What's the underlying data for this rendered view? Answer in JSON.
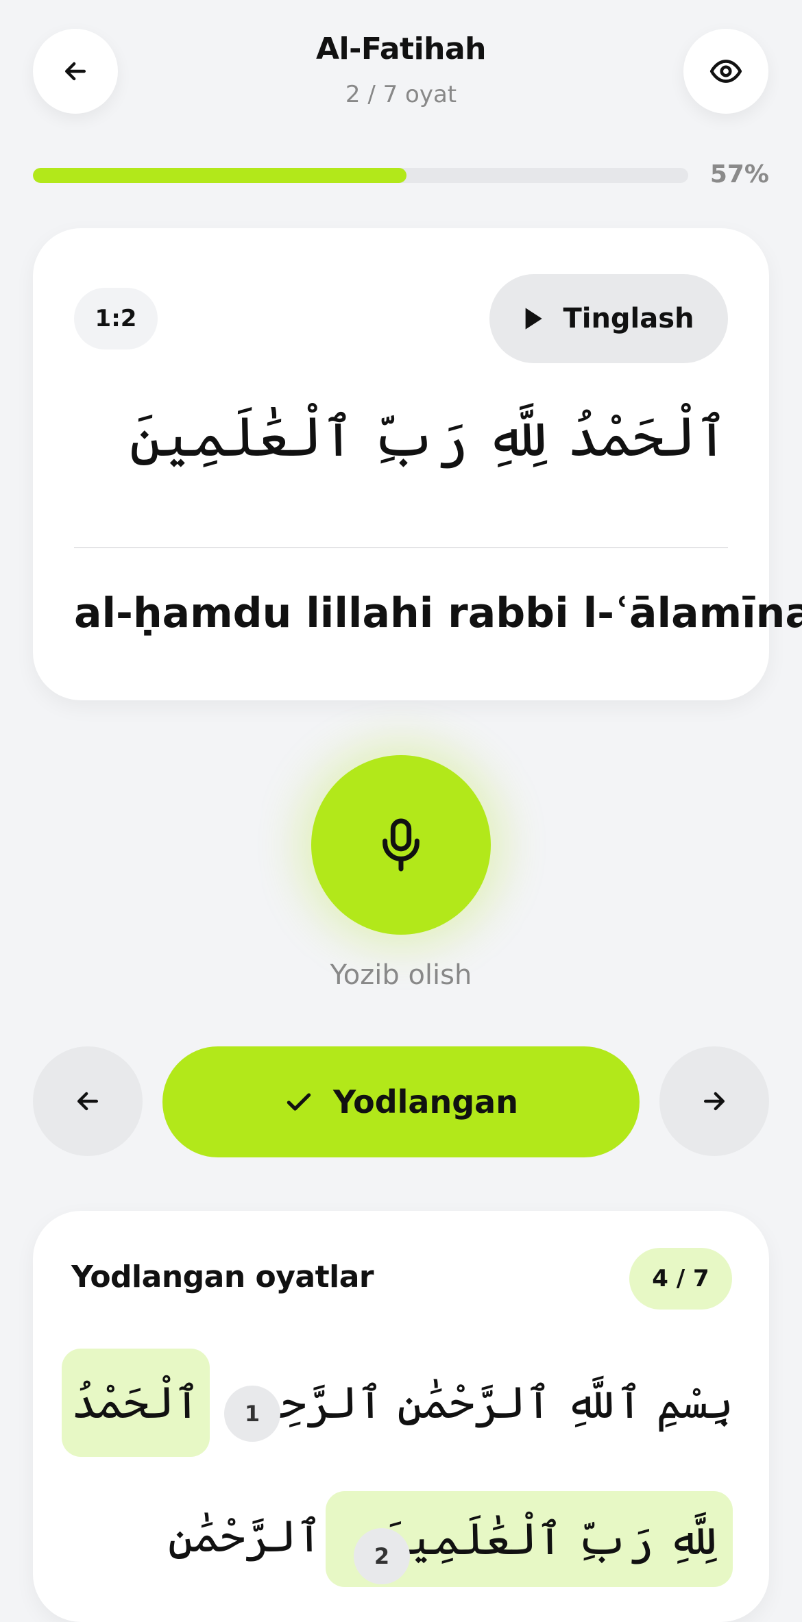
{
  "header": {
    "title": "Al-Fatihah",
    "subtitle": "2 / 7 oyat",
    "back_icon": "arrow-left-icon",
    "eye_icon": "eye-icon"
  },
  "progress": {
    "percent": 57,
    "label": "57%"
  },
  "verse": {
    "ref": "1:2",
    "listen_label": "Tinglash",
    "arabic": "ٱلْحَمْدُ لِلَّهِ رَبِّ ٱلْعَٰلَمِينَ",
    "transliteration": "al-ḥamdu lillahi rabbi l-ʿālamīna"
  },
  "record": {
    "label": "Yozib olish",
    "icon": "microphone-icon"
  },
  "actions": {
    "memorized_label": "Yodlangan",
    "prev_icon": "arrow-left-icon",
    "next_icon": "arrow-right-icon"
  },
  "memorized_list": {
    "title": "Yodlangan oyatlar",
    "count": "4 / 7",
    "line1": {
      "verse": "بِسْمِ ٱللَّهِ ٱلرَّحْمَٰنِ ٱلرَّحِيمِ",
      "num": "1",
      "highlight": "ٱلْحَمْدُ"
    },
    "line2": {
      "highlight": "لِلَّهِ رَبِّ ٱلْعَٰلَمِينَ",
      "num": "2",
      "rest": "ٱلرَّحْمَٰنِ"
    }
  },
  "colors": {
    "accent": "#b2e81a",
    "accent_light": "#e7f8c5",
    "background": "#f3f4f6"
  }
}
